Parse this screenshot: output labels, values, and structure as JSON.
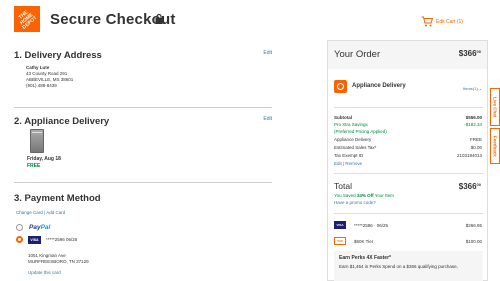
{
  "header": {
    "logo_text": "THE HOME DEPOT",
    "title": "Secure Checkout",
    "cart_link": "Edit Cart (1)"
  },
  "delivery_address": {
    "title": "1. Delivery Address",
    "edit": "Edit",
    "name": "Cathy Lute",
    "line1": "43 County Road 291",
    "line2": "ABBEVILLE, MS 38601",
    "phone": "(901) 488-8439"
  },
  "appliance_delivery": {
    "title": "2. Appliance Delivery",
    "edit": "Edit",
    "date": "Friday, Aug 18",
    "cost": "FREE"
  },
  "payment_method": {
    "title": "3. Payment Method",
    "links": "Change Card | Add Card",
    "paypal_a": "Pay",
    "paypal_b": "Pal",
    "card_brand": "VISA",
    "card_number": "*****2596  06/25",
    "billing_line1": "1051 Kingman Ave",
    "billing_line2": "MURFREESBORO, TN 37129",
    "update_link": "Update this card"
  },
  "order": {
    "title": "Your Order",
    "header_price_dollars": "366",
    "header_price_cents": "00",
    "section_label": "Appliance Delivery",
    "items_link": "Items(1)",
    "summary": [
      {
        "label": "Subtotal",
        "value": "$556.00",
        "style": "bold"
      },
      {
        "label": "Pro Xtra Savings",
        "value": "-$182.34",
        "style": "green"
      },
      {
        "label": "(Preferred Pricing Applied)",
        "value": "",
        "style": "green"
      },
      {
        "label": "Appliance Delivery",
        "value": "FREE",
        "style": ""
      },
      {
        "label": "Estimated Sales Tax*",
        "value": "$0.00",
        "style": ""
      },
      {
        "label": "Tax Exempt ID",
        "value": "2103184013",
        "style": ""
      }
    ],
    "summary_links": "Edit | Remove",
    "total_label": "Total",
    "total_dollars": "366",
    "total_cents": "00",
    "saved_prefix": "You Saved ",
    "saved_pct": "34% Off",
    "saved_suffix": " Your Item",
    "promo_link": "Have a promo code?",
    "payments": [
      {
        "badge": "VISA",
        "desc": "*****2596 · 06/25",
        "amount": "$266.95"
      },
      {
        "badge": "TAX",
        "desc": "$60K Tier",
        "amount": "$100.00"
      }
    ],
    "perks_title": "Earn Perks 4X Faster*",
    "perks_text": "Earn $1,464 in Perks Spend on a $366 qualifying purchase,"
  },
  "side_tabs": {
    "live_chat": "Live Chat",
    "feedback": "Feedback"
  },
  "colors": {
    "brand": "#f96302",
    "link": "#3e7697",
    "success": "#00873c"
  }
}
